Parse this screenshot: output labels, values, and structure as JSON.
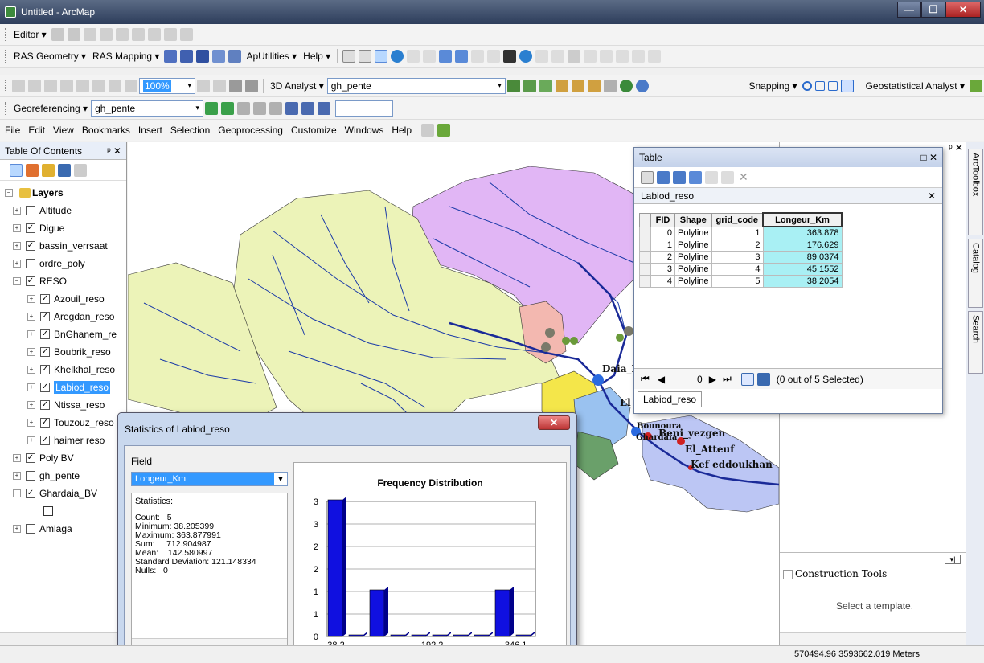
{
  "window": {
    "title": "Untitled - ArcMap"
  },
  "toolbars": {
    "editor_label": "Editor ▾",
    "ras_geometry": "RAS Geometry ▾",
    "ras_mapping": "RAS Mapping ▾",
    "aputilities": "ApUtilities ▾",
    "help": "Help ▾",
    "zoom_value": "100%",
    "analyst_3d": "3D Analyst ▾",
    "layer_combo": "gh_pente",
    "snapping": "Snapping ▾",
    "geostat": "Geostatistical Analyst ▾",
    "georeferencing": "Georeferencing ▾",
    "georef_layer": "gh_pente"
  },
  "menu": [
    "File",
    "Edit",
    "View",
    "Bookmarks",
    "Insert",
    "Selection",
    "Geoprocessing",
    "Customize",
    "Windows",
    "Help"
  ],
  "toc": {
    "title": "Table Of Contents",
    "pin": "ᵖ ✕",
    "layers_label": "Layers",
    "items": [
      {
        "name": "Altitude",
        "checked": false,
        "indent": 1
      },
      {
        "name": "Digue",
        "checked": true,
        "indent": 1
      },
      {
        "name": "bassin_verrsaat",
        "checked": true,
        "indent": 1
      },
      {
        "name": "ordre_poly",
        "checked": false,
        "indent": 1
      },
      {
        "name": "RESO",
        "checked": true,
        "indent": 1,
        "expanded": true
      },
      {
        "name": "Azouil_reso",
        "checked": true,
        "indent": 2
      },
      {
        "name": "Aregdan_reso",
        "checked": true,
        "indent": 2
      },
      {
        "name": "BnGhanem_re",
        "checked": true,
        "indent": 2
      },
      {
        "name": "Boubrik_reso",
        "checked": true,
        "indent": 2
      },
      {
        "name": "Khelkhal_reso",
        "checked": true,
        "indent": 2
      },
      {
        "name": "Labiod_reso",
        "checked": true,
        "indent": 2,
        "selected": true
      },
      {
        "name": "Ntissa_reso",
        "checked": true,
        "indent": 2
      },
      {
        "name": "Touzouz_reso",
        "checked": true,
        "indent": 2
      },
      {
        "name": "haimer reso",
        "checked": true,
        "indent": 2
      },
      {
        "name": "Poly BV",
        "checked": true,
        "indent": 1
      },
      {
        "name": "gh_pente",
        "checked": false,
        "indent": 1
      },
      {
        "name": "Ghardaia_BV",
        "checked": true,
        "indent": 1,
        "expanded": true
      },
      {
        "name": "",
        "checked": false,
        "indent": 2,
        "symbol": true
      },
      {
        "name": "Amlaga",
        "checked": false,
        "indent": 1
      }
    ]
  },
  "map": {
    "labels": [
      "Daia_B",
      "El",
      "Bounoura",
      "Ghardaia",
      "Beni_yezgen",
      "El_Atteuf",
      "Kef eddoukhan"
    ]
  },
  "table": {
    "window_title": "Table",
    "tab_name": "Labiod_reso",
    "columns": [
      "FID",
      "Shape",
      "grid_code",
      "Longeur_Km"
    ],
    "rows": [
      [
        "0",
        "Polyline",
        "1",
        "363.878"
      ],
      [
        "1",
        "Polyline",
        "2",
        "176.629"
      ],
      [
        "2",
        "Polyline",
        "3",
        "89.0374"
      ],
      [
        "3",
        "Polyline",
        "4",
        "45.1552"
      ],
      [
        "4",
        "Polyline",
        "5",
        "38.2054"
      ]
    ],
    "record": "0",
    "selection": "(0 out of 5 Selected)",
    "bottom_tab": "Labiod_reso"
  },
  "stats": {
    "title": "Statistics of Labiod_reso",
    "field_label": "Field",
    "field_value": "Longeur_Km",
    "stats_header": "Statistics:",
    "lines": [
      "Count:   5",
      "Minimum: 38.205399",
      "Maximum: 363.877991",
      "Sum:     712.904987",
      "Mean:    142.580997",
      "Standard Deviation: 121.148334",
      "Nulls:   0"
    ]
  },
  "chart_data": {
    "type": "bar",
    "title": "Frequency Distribution",
    "categories": [
      "38.2",
      "",
      "",
      "",
      "",
      "192.2",
      "",
      "",
      "",
      "346.1"
    ],
    "values": [
      3,
      0,
      1,
      0,
      0,
      0,
      0,
      0,
      1,
      0
    ],
    "tick_labels_x": [
      "38.2",
      "192.2",
      "346.1"
    ],
    "tick_labels_y": [
      "0",
      "1",
      "1",
      "2",
      "2",
      "3",
      "3"
    ],
    "ylim": [
      0,
      3
    ],
    "bar_color": "#1010e0"
  },
  "right_panel": {
    "construction_tools": "Construction Tools",
    "select_template": "Select a template."
  },
  "sidebar_tabs": [
    "ArcToolbox",
    "Catalog",
    "Search"
  ],
  "status": {
    "coords": "570494.96  3593662.019 Meters"
  }
}
